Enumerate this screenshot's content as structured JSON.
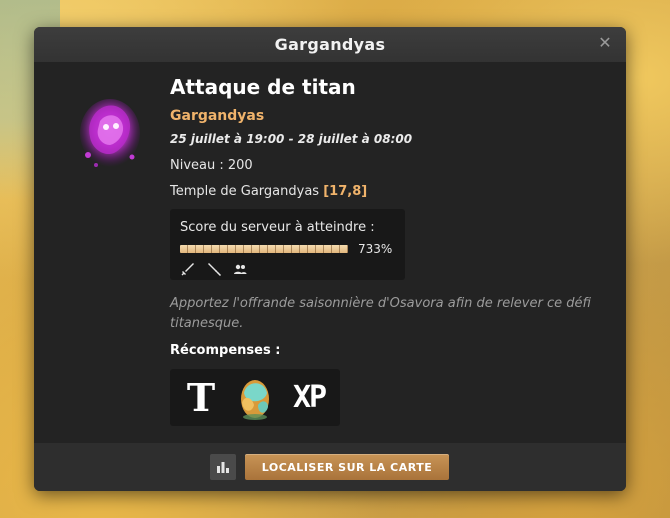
{
  "window": {
    "title": "Gargandyas"
  },
  "event": {
    "title": "Attaque de titan",
    "subtitle": "Gargandyas",
    "dates": "25 juillet à 19:00 - 28 juillet à 08:00",
    "level_label": "Niveau :",
    "level_value": "200",
    "location_text": "Temple de Gargandyas",
    "location_coords": "[17,8]",
    "score": {
      "label": "Score du serveur à atteindre :",
      "percent_text": "733%",
      "fill_fraction": 1.0,
      "icons": [
        "sword-icon",
        "dagger-icon",
        "group-icon"
      ]
    },
    "description": "Apportez l'offrande saisonnière d'Osavora afin de relever ce défi titanesque.",
    "rewards_label": "Récompenses :",
    "rewards": [
      {
        "icon": "title-reward-icon",
        "text": "T"
      },
      {
        "icon": "egg-reward-icon",
        "text": ""
      },
      {
        "icon": "xp-reward-icon",
        "text": "XP"
      }
    ]
  },
  "footer": {
    "stats_icon": "bar-chart-icon",
    "locate_label": "LOCALISER SUR LA CARTE"
  },
  "colors": {
    "accent_orange": "#f0b36b",
    "button_brown": "#b9824a",
    "panel_bg": "#232323"
  }
}
